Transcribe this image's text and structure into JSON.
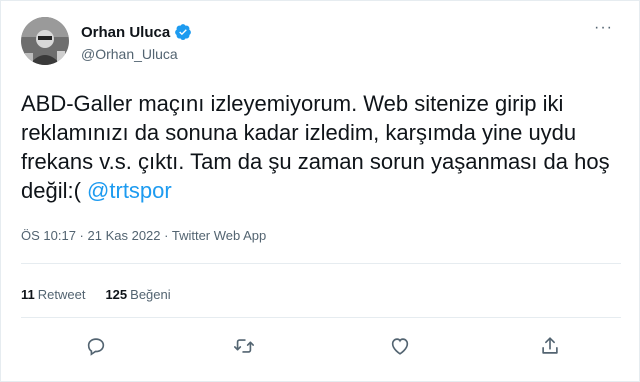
{
  "author": {
    "display_name": "Orhan Uluca",
    "handle": "@Orhan_Uluca",
    "verified": true,
    "verified_color": "#1d9bf0"
  },
  "tweet": {
    "text": "ABD-Galler maçını izleyemiyorum. Web sitenize girip iki reklamınızı da sonuna kadar izledim, karşımda yine uydu frekans v.s. çıktı.  Tam da şu zaman sorun yaşanması da hoş değil:( ",
    "mention": "@trtspor",
    "mention_color": "#1d9bf0",
    "time": "ÖS 10:17",
    "separator": " · ",
    "date": "21 Kas 2022",
    "client": "Twitter Web App"
  },
  "stats": {
    "retweets_count": "11",
    "retweets_label": "Retweet",
    "likes_count": "125",
    "likes_label": "Beğeni"
  },
  "actions": {
    "icons": [
      "reply-icon",
      "retweet-icon",
      "like-icon",
      "share-icon"
    ]
  },
  "colors": {
    "text": "#0f1419",
    "secondary": "#536471",
    "border": "#e6ecf0"
  }
}
